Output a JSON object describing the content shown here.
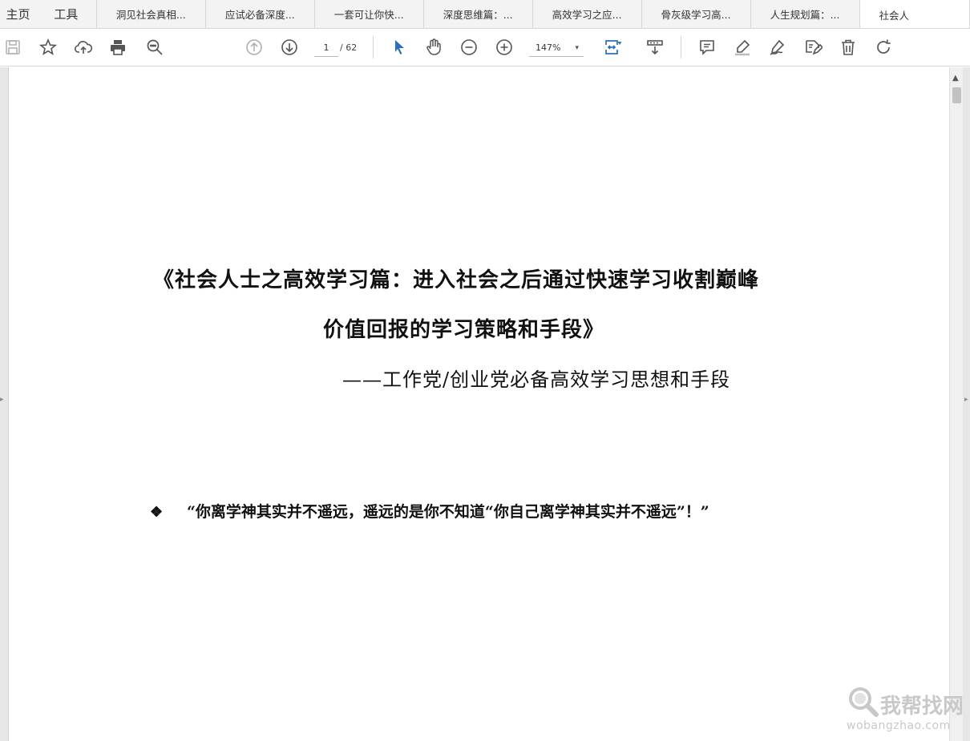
{
  "menu": {
    "home": "主页",
    "tools": "工具"
  },
  "tabs": [
    {
      "label": "洞见社会真相..."
    },
    {
      "label": "应试必备深度..."
    },
    {
      "label": "一套可让你快..."
    },
    {
      "label": "深度思维篇：..."
    },
    {
      "label": "高效学习之应..."
    },
    {
      "label": "骨灰级学习高..."
    },
    {
      "label": "人生规划篇：..."
    },
    {
      "label": "社会人"
    }
  ],
  "toolbar": {
    "page_current": "1",
    "page_total": "/ 62",
    "zoom": "147%",
    "zoom_caret": "▾",
    "icons": {
      "save": "save-icon",
      "bookmark": "star-icon",
      "upload": "cloud-upload-icon",
      "print": "printer-icon",
      "find": "search-icon",
      "prev": "arrow-up-circle-icon",
      "next": "arrow-down-circle-icon",
      "select": "cursor-icon",
      "hand": "hand-icon",
      "zoom_out": "zoom-out-icon",
      "zoom_in": "zoom-in-icon",
      "fit": "fit-page-icon",
      "scroll_mode": "scroll-mode-icon",
      "comment": "comment-icon",
      "highlight": "highlight-icon",
      "sign": "sign-icon",
      "stamp": "stamp-icon",
      "delete": "trash-icon",
      "rotate": "rotate-icon"
    },
    "accent_color": "#2b6fb7"
  },
  "document": {
    "title_line1": "《社会人士之高效学习篇：进入社会之后通过快速学习收割巅峰",
    "title_line2": "价值回报的学习策略和手段》",
    "subtitle": "——工作党/创业党必备高效学习思想和手段",
    "bullet": "❖",
    "quote": "“你离学神其实并不遥远，遥远的是你不知道“你自己离学神其实并不遥远”！”"
  },
  "scrollbar": {
    "up_arrow": "▲"
  },
  "side_arrows": {
    "left": "▸",
    "right": "▸"
  },
  "watermark": {
    "title": "我帮找网",
    "domain": "wobangzhao.com"
  }
}
